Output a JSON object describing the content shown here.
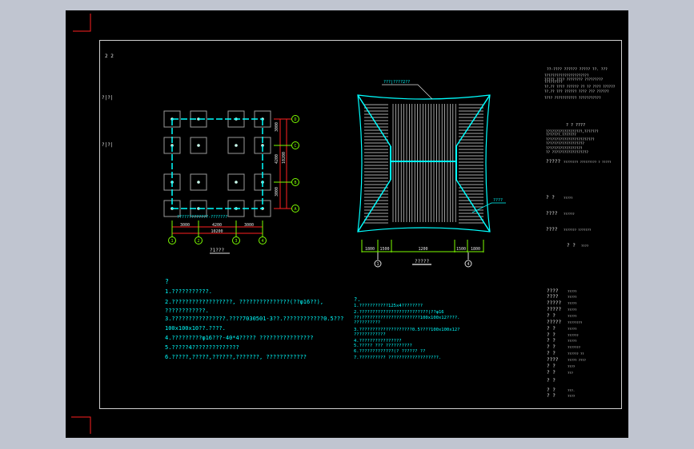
{
  "colors": {
    "background": "#c0c5d0",
    "paper": "#000000",
    "frame": "#d0d0d0",
    "accent_cyan": "#00ffff",
    "axis_green": "#7cfc00",
    "dimension_red": "#ff2020"
  },
  "sheet_marks": {
    "top_left": "2 2",
    "vertical_1": "?|?|",
    "vertical_2": "?|?|"
  },
  "plan": {
    "title": "?1???",
    "note_label": "?????????????-???????",
    "axis_rows": [
      "D",
      "C",
      "B",
      "A"
    ],
    "axis_cols": [
      "1",
      "2",
      "3",
      "4"
    ],
    "dims_top": [
      "3000",
      "4200",
      "3000"
    ],
    "dim_total": "10200",
    "dims_side": [
      "3000",
      "4200",
      "3000"
    ],
    "dim_side_total": "10200"
  },
  "roof": {
    "title": "?????",
    "label_top": "???|????2??",
    "label_right": "????",
    "dims": [
      "1800",
      "1500",
      "1200",
      "1500",
      "1800"
    ],
    "axis": [
      "1",
      "4"
    ]
  },
  "notes_left": {
    "heading": "?",
    "lines": [
      "1.???????????.",
      "2.??????????????????, ???????????????(??φ16??),",
      "  ????????????.",
      "3.????????????????.????7030501-3??.????????????0.5???",
      "  100x100x10??.????.",
      "4.?????????φ16???-40*4????? ????????????????",
      "5.?????4??????????????",
      "6.?????,?????,??????,???????, ????????????"
    ]
  },
  "notes_right": {
    "heading": "?.",
    "lines": [
      "1.???????????125x4????????",
      "2.??????????????????????????(??φ16",
      "  ??)??????????????????????100x100x12????.",
      "  ??????????",
      "3.????????????????????0.5????100x100x12?",
      "  ????????????",
      "4.????????????????",
      "5.????? ??? ??????????",
      "6.?????????????(? ?????? ??",
      "7.?????????? ???????????????????."
    ]
  },
  "title_block": {
    "header": "??-???? ??????  ????? ??. ???",
    "rows": [
      "??????????????????????",
      "????? ???? ???????? ?????????",
      "   ?????????",
      "??.?? ???? ?????? ?? ?? ???? ??????",
      "??.?? ??? ?????? ???? ??? ??????",
      "????  ???????????  ???????????"
    ],
    "notes_heading": "?  ? ????",
    "notes": [
      "??????????????????,???????",
      "???????.???????",
      "????????????????????????",
      "???????????????????",
      "  ??????????????????",
      "?? ??????????????????"
    ],
    "fields": [
      {
        "label": "?????",
        "value": "???????? ????????? ? ?????"
      },
      {
        "label": "?  ?",
        "value": "?????"
      },
      {
        "label": "????",
        "value": "??????"
      },
      {
        "label": "????",
        "value": "??????? ???????"
      },
      {
        "label": "?  ?",
        "value": "????"
      }
    ]
  },
  "sign_table": [
    {
      "label": "????",
      "value": "?????"
    },
    {
      "label": "????",
      "value": "?????"
    },
    {
      "label": "?????",
      "value": "?????"
    },
    {
      "label": "?????",
      "value": "?????"
    },
    {
      "label": "?   ?",
      "value": "?????"
    },
    {
      "label": "?????",
      "value": "????????"
    },
    {
      "label": "?   ?",
      "value": "?????"
    },
    {
      "label": "?   ?",
      "value": "??????"
    },
    {
      "label": "?   ?",
      "value": "?????"
    },
    {
      "label": "?   ?",
      "value": "???????"
    },
    {
      "label": "?   ?",
      "value": "?????? ??"
    },
    {
      "label": "????",
      "value": "????? ????"
    },
    {
      "label": "?   ?",
      "value": "????"
    },
    {
      "label": "?   ?",
      "value": "???"
    },
    {
      "label": "?   ?",
      "value": ""
    },
    {
      "label": "?   ?",
      "value": "???-"
    },
    {
      "label": "?   ?",
      "value": "????"
    }
  ]
}
